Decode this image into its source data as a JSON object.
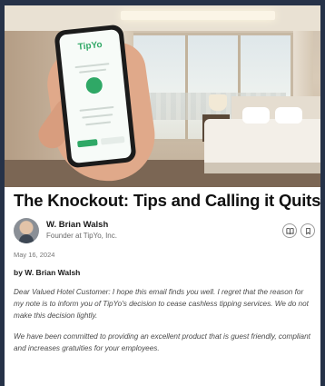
{
  "hero": {
    "phone_brand": "TipYo"
  },
  "article": {
    "title": "The Knockout: Tips and Calling it Quits",
    "author": {
      "name": "W. Brian Walsh",
      "role": "Founder at TipYo, Inc."
    },
    "actions": [
      {
        "icon": "book-icon"
      },
      {
        "icon": "bookmark-icon"
      }
    ],
    "date": "May 16, 2024",
    "byline": "by W. Brian Walsh",
    "paragraphs": [
      "Dear Valued Hotel Customer: I hope this email finds you well. I regret that the reason for my note is to inform you of TipYo's decision to cease cashless tipping services. We do not make this decision lightly.",
      "We have been committed to providing an excellent product that is guest friendly, compliant and increases gratuities for your employees."
    ]
  },
  "colors": {
    "background": "#263248",
    "card": "#ffffff",
    "brand_green": "#2fa866"
  }
}
